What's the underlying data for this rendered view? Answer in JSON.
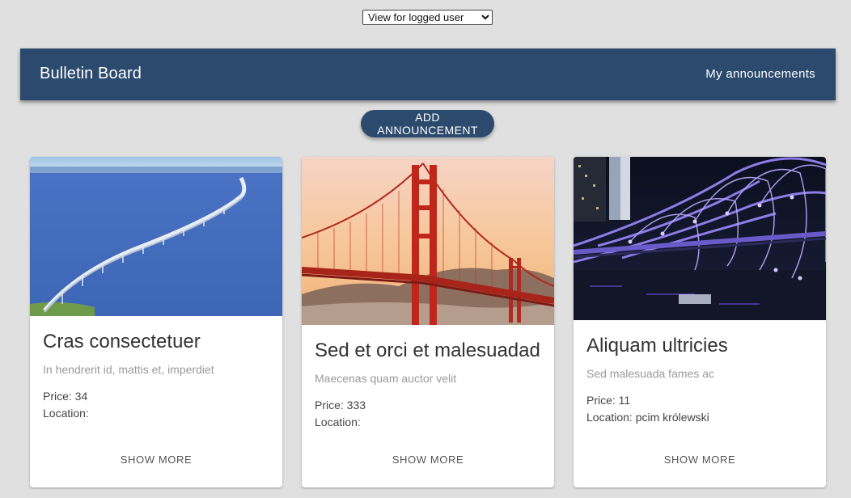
{
  "view_select": {
    "selected": "View for logged user"
  },
  "header": {
    "title": "Bulletin Board",
    "my_announcements_label": "My announcements"
  },
  "add_button_label": "ADD ANNOUNCEMENT",
  "cards": [
    {
      "title": "Cras consectetuer",
      "subtitle": "In hendrerit id, mattis et, imperdiet",
      "price": "Price: 34",
      "location": "Location:",
      "action": "SHOW MORE",
      "image": "long-bridge-over-sea"
    },
    {
      "title": "Sed et orci et malesuadad",
      "subtitle": "Maecenas quam auctor velit",
      "price": "Price: 333",
      "location": "Location:",
      "action": "SHOW MORE",
      "image": "golden-gate-bridge"
    },
    {
      "title": "Aliquam ultricies",
      "subtitle": "Sed malesuada fames ac",
      "price": "Price: 11",
      "location": "Location: pcim królewski",
      "action": "SHOW MORE",
      "image": "helix-bridge-night"
    }
  ]
}
